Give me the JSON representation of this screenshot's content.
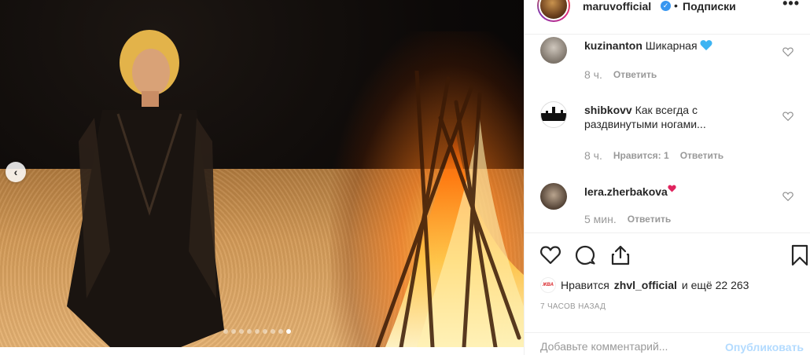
{
  "post": {
    "username": "maruvofficial",
    "separator": "•",
    "follow_label": "Подписки",
    "more_label": "•••",
    "carousel": {
      "total": 9,
      "active": 8
    }
  },
  "comments": [
    {
      "user": "kuzinanton",
      "text": "Шикарная",
      "emoji": "blue-heart",
      "time": "8 ч.",
      "likes": "",
      "reply": "Ответить"
    },
    {
      "user": "shibkovv",
      "text": "Как всегда с раздвинутыми ногами...",
      "time": "8 ч.",
      "likes": "Нравится: 1",
      "reply": "Ответить"
    },
    {
      "user": "lera.zherbakova",
      "text": "",
      "emoji": "red-heart",
      "time": "5 мин.",
      "likes": "",
      "reply": "Ответить"
    }
  ],
  "likes": {
    "prefix": "Нравится",
    "user": "zhvl_official",
    "suffix": "и ещё 22 263",
    "avatar_text": "ЖВА"
  },
  "timestamp": "7 ЧАСОВ НАЗАД",
  "comment_box": {
    "placeholder": "Добавьте комментарий...",
    "publish_label": "Опубликовать"
  },
  "icons": {
    "like": "heart-icon",
    "comment": "comment-icon",
    "share": "share-icon",
    "save": "bookmark-icon",
    "verified": "verified-badge-icon"
  },
  "colors": {
    "verified": "#3897f0",
    "muted": "#999999",
    "publish_disabled": "#b3dbff",
    "blue_heart": "#3db4f2",
    "red_heart": "#e0245e"
  }
}
